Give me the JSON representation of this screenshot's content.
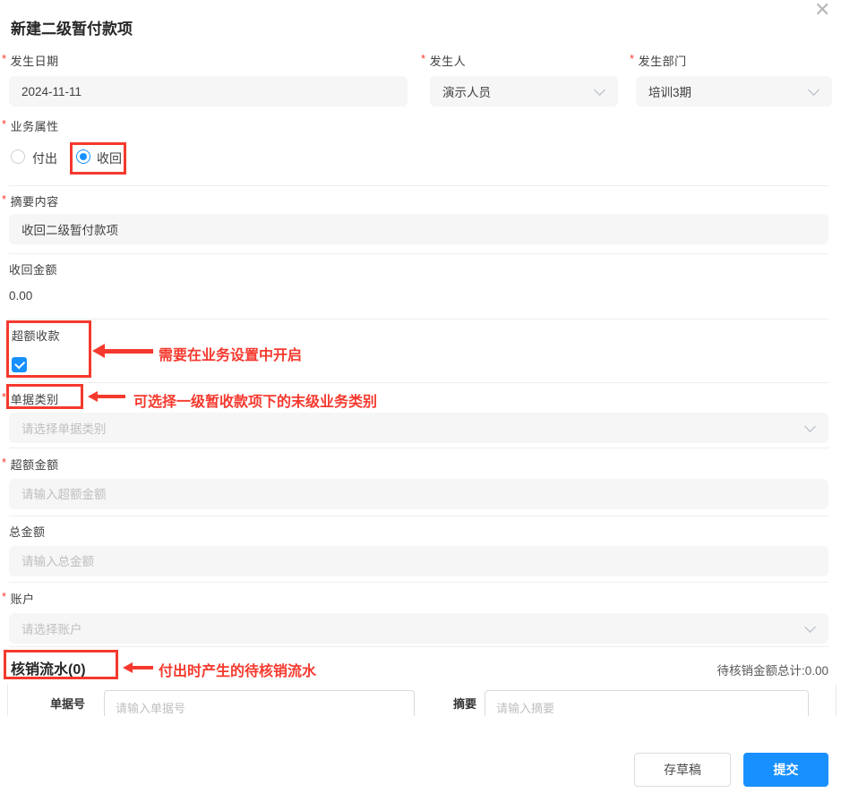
{
  "ui": {
    "required_mark": "*",
    "close_glyph": "✕"
  },
  "header": {
    "title": "新建二级暂付款项"
  },
  "fields": {
    "occur_date": {
      "label": "发生日期",
      "required": true,
      "value": "2024-11-11"
    },
    "occur_person": {
      "label": "发生人",
      "required": true,
      "value": "演示人员"
    },
    "occur_dept": {
      "label": "发生部门",
      "required": true,
      "value": "培训3期"
    },
    "biz_attr": {
      "label": "业务属性",
      "required": true,
      "options": [
        {
          "label": "付出",
          "selected": false
        },
        {
          "label": "收回",
          "selected": true
        }
      ]
    },
    "summary": {
      "label": "摘要内容",
      "required": true,
      "value": "收回二级暂付款项"
    },
    "recover_amount": {
      "label": "收回金额",
      "value": "0.00"
    },
    "excess_receipt": {
      "label": "超额收款",
      "checked": true
    },
    "doc_category": {
      "label": "单据类别",
      "required": true,
      "placeholder": "请选择单据类别"
    },
    "excess_amount": {
      "label": "超额金额",
      "required": true,
      "placeholder": "请输入超额金额"
    },
    "total_amount": {
      "label": "总金额",
      "placeholder": "请输入总金额"
    },
    "account": {
      "label": "账户",
      "required": true,
      "placeholder": "请选择账户"
    }
  },
  "annotations": {
    "excess_note": "需要在业务设置中开启",
    "category_note": "可选择一级暂收款项下的末级业务类别",
    "writeoff_note": "付出时产生的待核销流水"
  },
  "writeoff": {
    "title": "核销流水(0)",
    "total_summary": "待核销金额总计:0.00",
    "doc_no_label": "单据号",
    "doc_no_placeholder": "请输入单据号",
    "summary_label": "摘要",
    "summary_placeholder": "请输入摘要"
  },
  "footer": {
    "draft_label": "存草稿",
    "submit_label": "提交"
  },
  "colors": {
    "accent_blue": "#1890ff",
    "annotation_red": "#f5392e",
    "input_bg": "#f6f6f7",
    "placeholder_gray": "#bfbfbf"
  }
}
